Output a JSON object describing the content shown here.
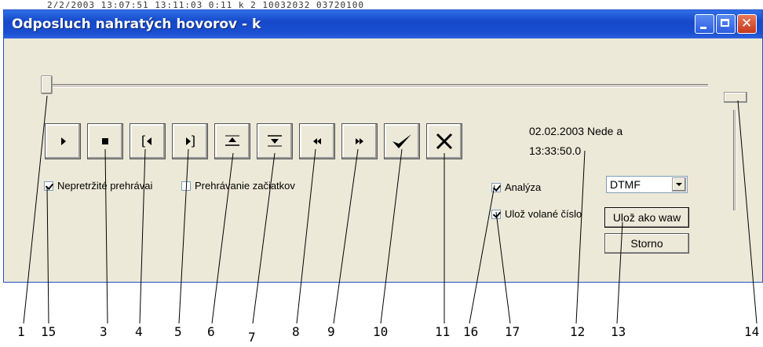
{
  "background": {
    "top_row": "2/2/2003  13:07:51        13:11:03           0:11  k                     2 10032032        03720100",
    "bottom_row": "                                                                           "
  },
  "window": {
    "title": "Odposluch nahratých hovorov - k",
    "close_glyph": "✕"
  },
  "player": {
    "position_fraction": 0.0,
    "volume_fraction": 1.0,
    "buttons": [
      {
        "name": "play-button",
        "icon": "play-icon"
      },
      {
        "name": "stop-button",
        "icon": "stop-icon"
      },
      {
        "name": "go-to-start-button",
        "icon": "skip-start-icon"
      },
      {
        "name": "go-to-end-button",
        "icon": "skip-end-icon"
      },
      {
        "name": "mark-start-button",
        "icon": "mark-up-icon"
      },
      {
        "name": "mark-end-button",
        "icon": "mark-down-icon"
      },
      {
        "name": "rewind-button",
        "icon": "rewind-icon"
      },
      {
        "name": "fast-forward-button",
        "icon": "fast-forward-icon"
      },
      {
        "name": "confirm-button",
        "icon": "checkmark-icon"
      },
      {
        "name": "cancel-button",
        "icon": "x-icon"
      }
    ]
  },
  "options": {
    "continuous_play": {
      "label": "Nepretržité prehrávai",
      "checked": true
    },
    "play_starts": {
      "label": "Prehrávanie začiatkov",
      "checked": false
    },
    "analysis": {
      "label": "Analýza",
      "checked": true
    },
    "save_number": {
      "label": "Ulož volané číslo",
      "checked": true
    }
  },
  "info": {
    "date_line": "02.02.2003 Nede a",
    "time_line": "13:33:50.0"
  },
  "analysis_type": {
    "selected": "DTMF"
  },
  "actions": {
    "save_wav": "Ulož ako waw",
    "storno": "Storno"
  },
  "callouts": [
    "1",
    "15",
    "3",
    "4",
    "5",
    "6",
    "7",
    "8",
    "9",
    "10",
    "11",
    "16",
    "17",
    "12",
    "13",
    "14"
  ]
}
